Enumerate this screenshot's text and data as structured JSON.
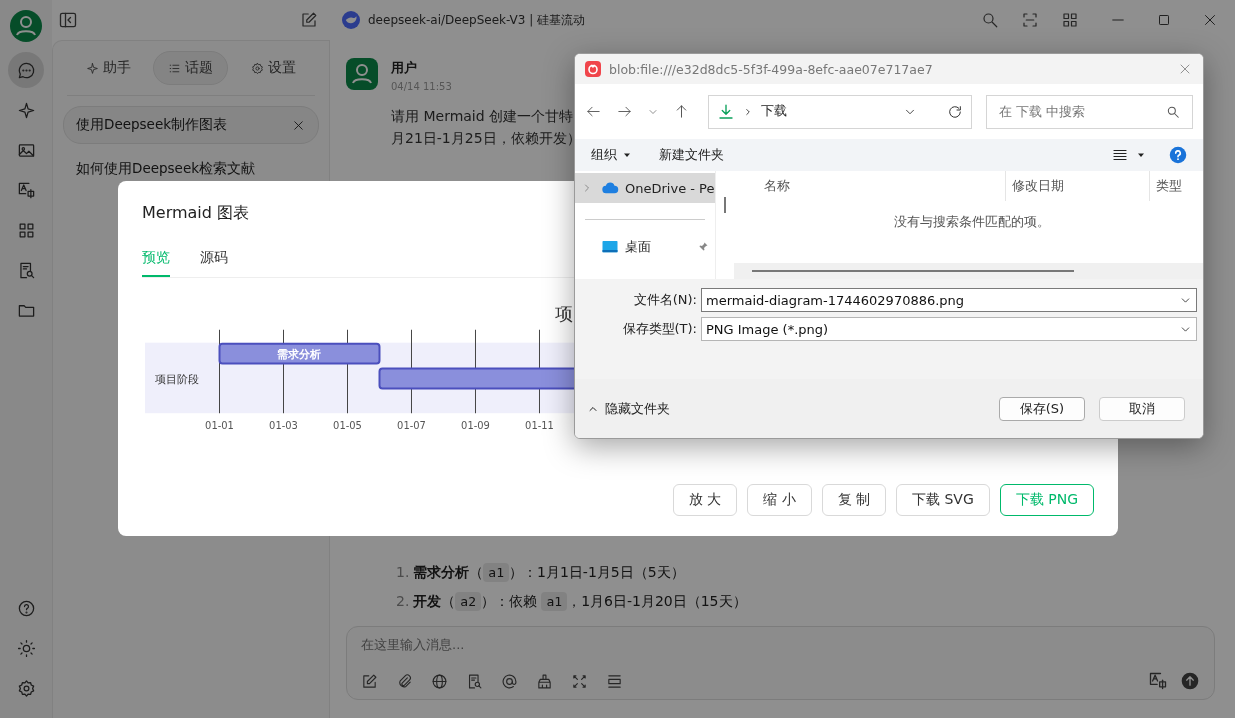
{
  "rail": {
    "top": [
      {
        "kind": "chat",
        "selected": true
      },
      {
        "kind": "sparkle",
        "selected": false
      },
      {
        "kind": "image",
        "selected": false
      },
      {
        "kind": "translate",
        "selected": false
      },
      {
        "kind": "grid",
        "selected": false
      },
      {
        "kind": "doc-search",
        "selected": false
      },
      {
        "kind": "folder",
        "selected": false
      }
    ],
    "bottom": [
      {
        "kind": "help"
      },
      {
        "kind": "sun"
      },
      {
        "kind": "gear"
      }
    ]
  },
  "topbar": {
    "title": "deepseek-ai/DeepSeek-V3 | 硅基流动",
    "tools": [
      {
        "kind": "search"
      },
      {
        "kind": "scan"
      },
      {
        "kind": "grid"
      }
    ],
    "window_controls": [
      {
        "kind": "minimize"
      },
      {
        "kind": "maximize"
      },
      {
        "kind": "close"
      }
    ]
  },
  "sidebar": {
    "tabs": [
      {
        "label": "助手",
        "kind": "sparkle",
        "selected": false
      },
      {
        "label": "话题",
        "kind": "list",
        "selected": true
      },
      {
        "label": "设置",
        "kind": "gear",
        "selected": false
      }
    ],
    "topics": [
      {
        "label": "使用Deepseek制作图表",
        "selected": true
      },
      {
        "label": "如何使用Deepseek检索文献",
        "selected": false
      }
    ]
  },
  "message": {
    "author": "用户",
    "time": "04/14 11:53",
    "lines": [
      "请用 Mermaid 创建一个甘特",
      "月21日-1月25日，依赖开发）"
    ]
  },
  "list": [
    {
      "number": "1.",
      "segments": [
        {
          "kind": "bold",
          "text": "需求分析"
        },
        {
          "kind": "text",
          "text": "（"
        },
        {
          "kind": "code",
          "text": "a1"
        },
        {
          "kind": "text",
          "text": "）：1月1日-1月5日（5天）"
        }
      ]
    },
    {
      "number": "2.",
      "segments": [
        {
          "kind": "bold",
          "text": "开发"
        },
        {
          "kind": "text",
          "text": "（"
        },
        {
          "kind": "code",
          "text": "a2"
        },
        {
          "kind": "text",
          "text": "）：依赖 "
        },
        {
          "kind": "code",
          "text": "a1"
        },
        {
          "kind": "text",
          "text": "，1月6日-1月20日（15天）"
        }
      ]
    }
  ],
  "composer": {
    "placeholder": "在这里输入消息...",
    "tools": [
      {
        "kind": "edit"
      },
      {
        "kind": "paperclip"
      },
      {
        "kind": "globe"
      },
      {
        "kind": "doc-search"
      },
      {
        "kind": "at"
      },
      {
        "kind": "brush"
      },
      {
        "kind": "expand"
      },
      {
        "kind": "rows"
      }
    ],
    "right_tools": [
      {
        "kind": "translate"
      },
      {
        "kind": "send"
      }
    ]
  },
  "modal": {
    "title": "Mermaid 图表",
    "tabs": [
      {
        "label": "预览",
        "selected": true
      },
      {
        "label": "源码",
        "selected": false
      }
    ],
    "gantt": {
      "title": "项",
      "section": "项目阶段",
      "ticks": [
        "01-01",
        "01-03",
        "01-05",
        "01-07",
        "01-09",
        "01-11"
      ],
      "tasks": [
        {
          "kind": "bar",
          "label": "需求分析"
        },
        {
          "kind": "bar"
        }
      ]
    },
    "buttons": [
      {
        "label": "放 大",
        "primary": false
      },
      {
        "label": "缩 小",
        "primary": false
      },
      {
        "label": "复 制",
        "primary": false
      },
      {
        "label": "下载 SVG",
        "primary": false
      },
      {
        "label": "下载 PNG",
        "primary": true
      }
    ]
  },
  "file_dialog": {
    "title": "blob:file:///e32d8dc5-5f3f-499a-8efc-aae07e717ae7",
    "path": "下载",
    "search_placeholder": "在 下载 中搜索",
    "organize": "组织",
    "new_folder": "新建文件夹",
    "nav_items": [
      {
        "label": "OneDrive - Pe",
        "kind": "cloud",
        "selected": true,
        "expandable": true,
        "pinned": false
      },
      {
        "label": "桌面",
        "kind": "desktop",
        "selected": false,
        "expandable": false,
        "pinned": true
      }
    ],
    "columns": [
      "名称",
      "修改日期",
      "类型"
    ],
    "empty_message": "没有与搜索条件匹配的项。",
    "fields": [
      {
        "label": "文件名(N):",
        "value": "mermaid-diagram-1744602970886.png"
      },
      {
        "label": "保存类型(T):",
        "value": "PNG Image (*.png)"
      }
    ],
    "hide_folders": "隐藏文件夹",
    "buttons": [
      {
        "label": "保存(S)",
        "default": true
      },
      {
        "label": "取消",
        "default": false
      }
    ]
  }
}
